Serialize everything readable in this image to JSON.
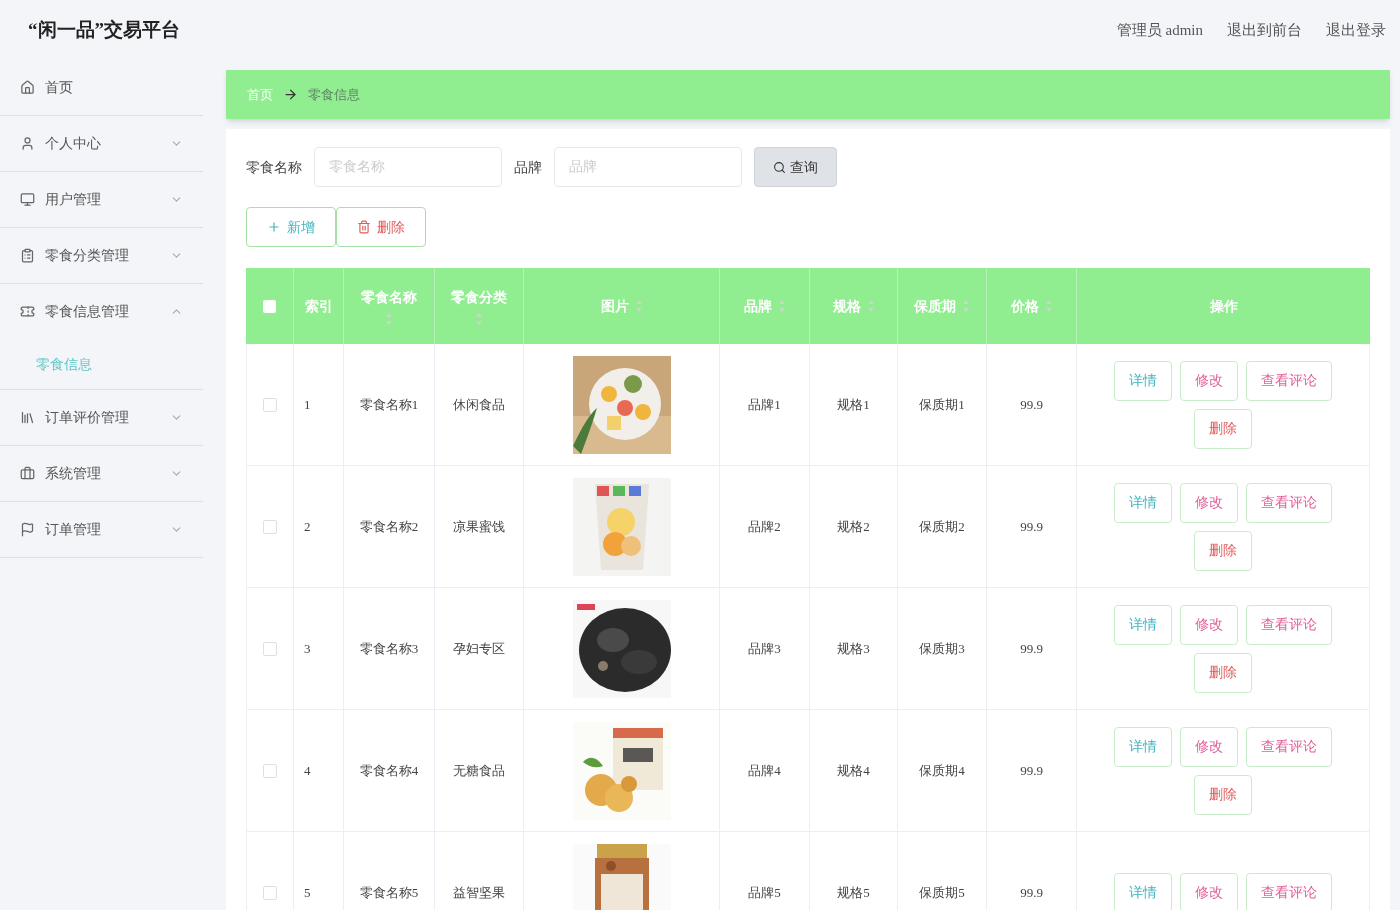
{
  "header": {
    "title": "“闲一品”交易平台",
    "links": [
      "管理员 admin",
      "退出到前台",
      "退出登录"
    ]
  },
  "sidebar": {
    "items": [
      {
        "label": "首页"
      },
      {
        "label": "个人中心",
        "expanded": false
      },
      {
        "label": "用户管理",
        "expanded": false
      },
      {
        "label": "零食分类管理",
        "expanded": false
      },
      {
        "label": "零食信息管理",
        "expanded": true,
        "children": [
          {
            "label": "零食信息",
            "selected": true
          }
        ]
      },
      {
        "label": "订单评价管理",
        "expanded": false
      },
      {
        "label": "系统管理",
        "expanded": false
      },
      {
        "label": "订单管理",
        "expanded": false
      }
    ]
  },
  "breadcrumb": [
    {
      "label": "首页",
      "current": false
    },
    {
      "label": "零食信息",
      "current": true
    }
  ],
  "search": {
    "fields": [
      {
        "label": "零食名称",
        "placeholder": "零食名称"
      },
      {
        "label": "品牌",
        "placeholder": "品牌"
      }
    ],
    "button": "查询"
  },
  "actions": [
    {
      "label": "新增",
      "kind": "add"
    },
    {
      "label": "删除",
      "kind": "delete"
    }
  ],
  "table": {
    "select_all_checked": false,
    "columns": [
      {
        "label": "索引",
        "sortable": false
      },
      {
        "label": "零食名称",
        "sortable": true
      },
      {
        "label": "零食分类",
        "sortable": true
      },
      {
        "label": "图片",
        "sortable": true
      },
      {
        "label": "品牌",
        "sortable": true
      },
      {
        "label": "规格",
        "sortable": true
      },
      {
        "label": "保质期",
        "sortable": true
      },
      {
        "label": "价格",
        "sortable": true
      },
      {
        "label": "操作",
        "sortable": false
      }
    ],
    "rows": [
      {
        "checked": false,
        "cells": [
          "1",
          "零食名称1",
          "休闲食品"
        ],
        "picture": {
          "kind": "picture"
        },
        "rest": [
          "品牌1",
          "规格1",
          "保质期1",
          "99.9"
        ],
        "buttons": [
          {
            "label": "详情",
            "kind": "detail"
          },
          {
            "label": "修改",
            "kind": "edit"
          },
          {
            "label": "查看评论",
            "kind": "comments"
          },
          {
            "label": "删除",
            "kind": "delete"
          }
        ]
      },
      {
        "checked": false,
        "cells": [
          "2",
          "零食名称2",
          "凉果蜜饯"
        ],
        "picture": {
          "kind": "picture"
        },
        "rest": [
          "品牌2",
          "规格2",
          "保质期2",
          "99.9"
        ],
        "buttons": [
          {
            "label": "详情",
            "kind": "detail"
          },
          {
            "label": "修改",
            "kind": "edit"
          },
          {
            "label": "查看评论",
            "kind": "comments"
          },
          {
            "label": "删除",
            "kind": "delete"
          }
        ]
      },
      {
        "checked": false,
        "cells": [
          "3",
          "零食名称3",
          "孕妇专区"
        ],
        "picture": {
          "kind": "picture"
        },
        "rest": [
          "品牌3",
          "规格3",
          "保质期3",
          "99.9"
        ],
        "buttons": [
          {
            "label": "详情",
            "kind": "detail"
          },
          {
            "label": "修改",
            "kind": "edit"
          },
          {
            "label": "查看评论",
            "kind": "comments"
          },
          {
            "label": "删除",
            "kind": "delete"
          }
        ]
      },
      {
        "checked": false,
        "cells": [
          "4",
          "零食名称4",
          "无糖食品"
        ],
        "picture": {
          "kind": "picture"
        },
        "rest": [
          "品牌4",
          "规格4",
          "保质期4",
          "99.9"
        ],
        "buttons": [
          {
            "label": "详情",
            "kind": "detail"
          },
          {
            "label": "修改",
            "kind": "edit"
          },
          {
            "label": "查看评论",
            "kind": "comments"
          },
          {
            "label": "删除",
            "kind": "delete"
          }
        ]
      },
      {
        "checked": false,
        "cells": [
          "5",
          "零食名称5",
          "益智坚果"
        ],
        "picture": {
          "kind": "picture"
        },
        "rest": [
          "品牌5",
          "规格5",
          "保质期5",
          "99.9"
        ],
        "buttons": [
          {
            "label": "详情",
            "kind": "detail"
          },
          {
            "label": "修改",
            "kind": "edit"
          },
          {
            "label": "查看评论",
            "kind": "comments"
          }
        ]
      }
    ]
  }
}
